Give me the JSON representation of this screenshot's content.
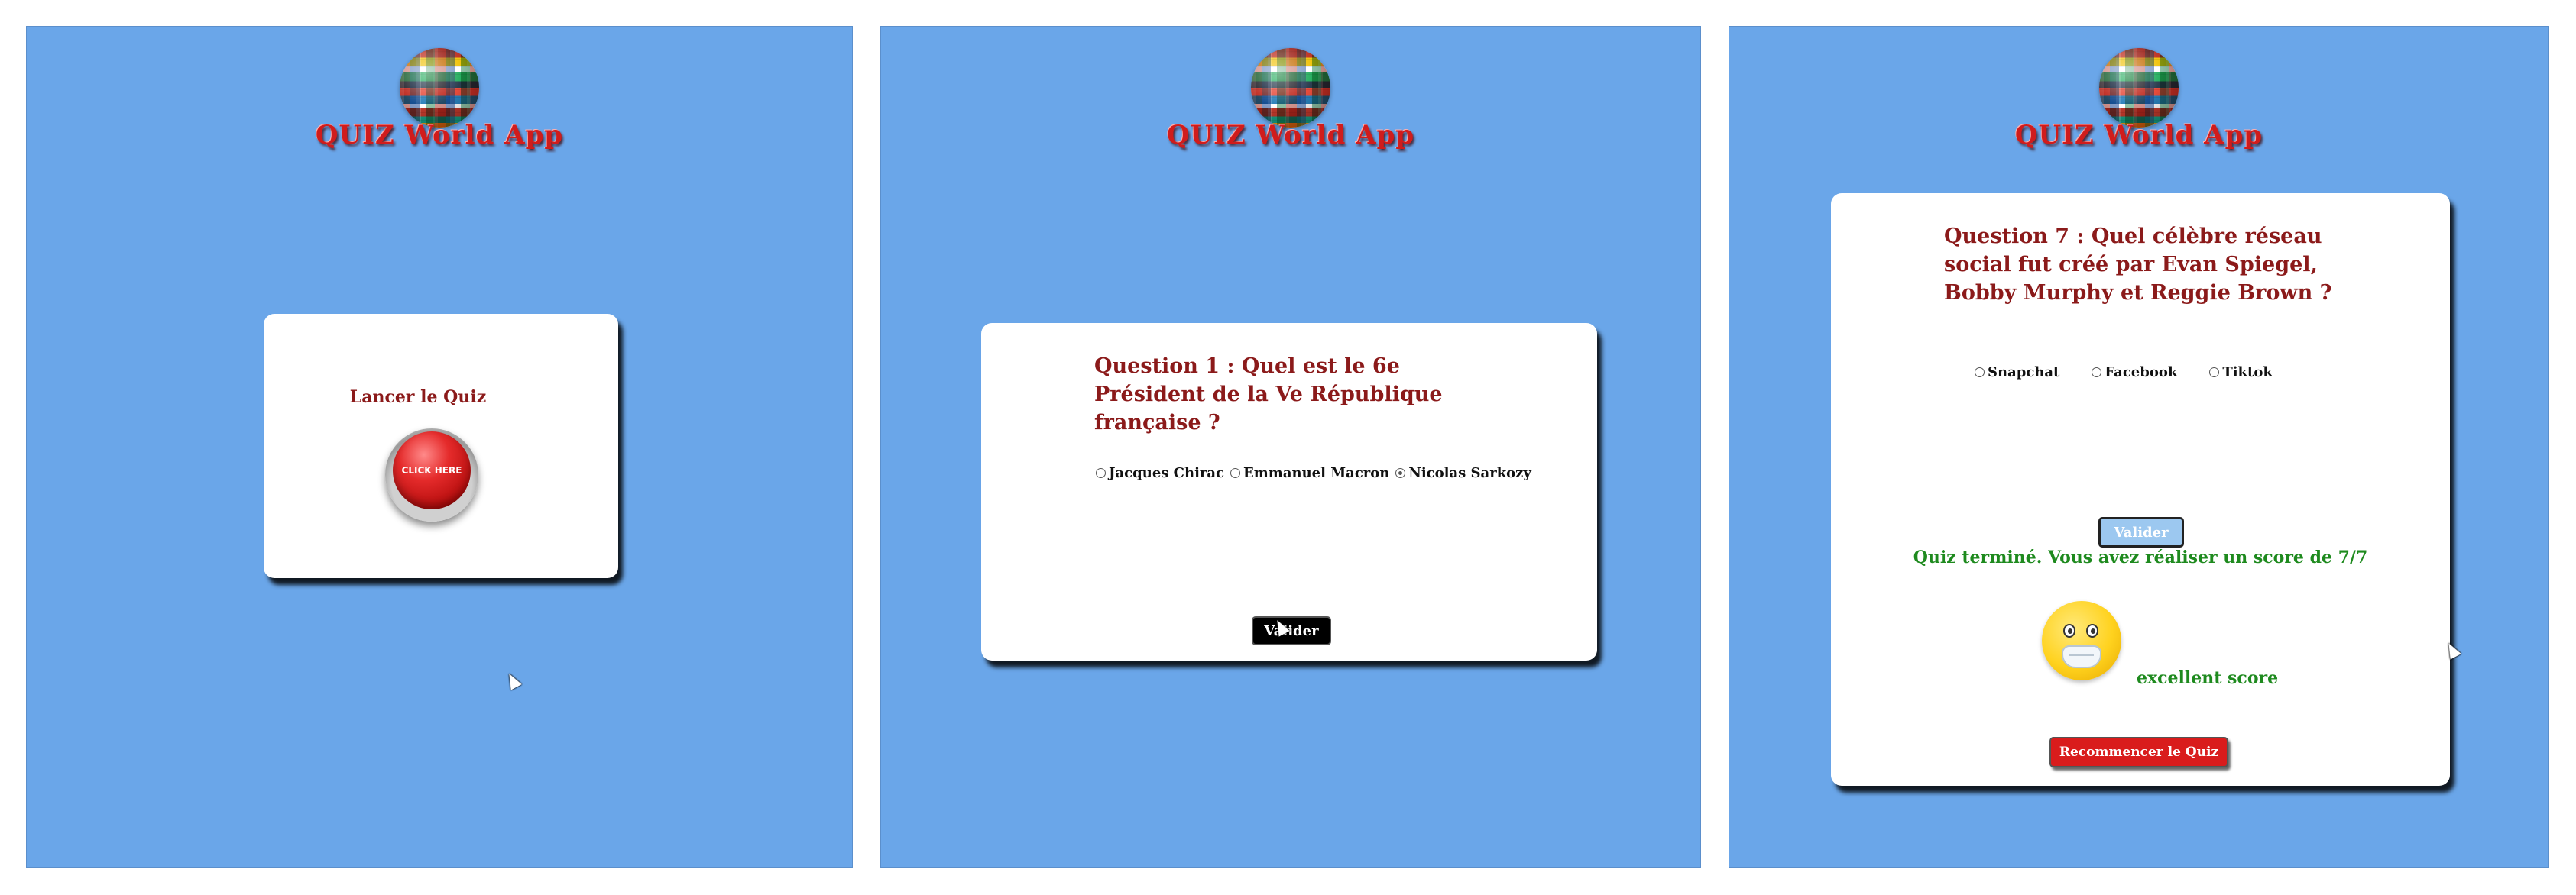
{
  "app": {
    "title": "QUIZ World App"
  },
  "screen1": {
    "launch_label": "Lancer le Quiz",
    "click_button_label": "CLICK HERE"
  },
  "screen2": {
    "question": "Question 1 : Quel est le 6e Président de la Ve République française ?",
    "options": [
      "Jacques Chirac",
      "Emmanuel Macron",
      "Nicolas Sarkozy"
    ],
    "selected_option": "Nicolas Sarkozy",
    "validate_label": "Valider"
  },
  "screen3": {
    "question": "Question 7 : Quel célèbre réseau social fut créé par Evan Spiegel, Bobby Murphy et Reggie Brown ?",
    "options": [
      "Snapchat",
      "Facebook",
      "Tiktok"
    ],
    "validate_label": "Valider",
    "result_text": "Quiz terminé. Vous avez réaliser un score de 7/7",
    "emoji_icon": "face-with-medical-mask-icon",
    "score_comment": "excellent score",
    "restart_label": "Recommencer le Quiz"
  },
  "colors": {
    "background": "#6aa6e9",
    "title_red": "#d01c1c",
    "question_red": "#8b1a1a",
    "result_green": "#1e8a1e",
    "restart_red": "#d91c1c"
  }
}
